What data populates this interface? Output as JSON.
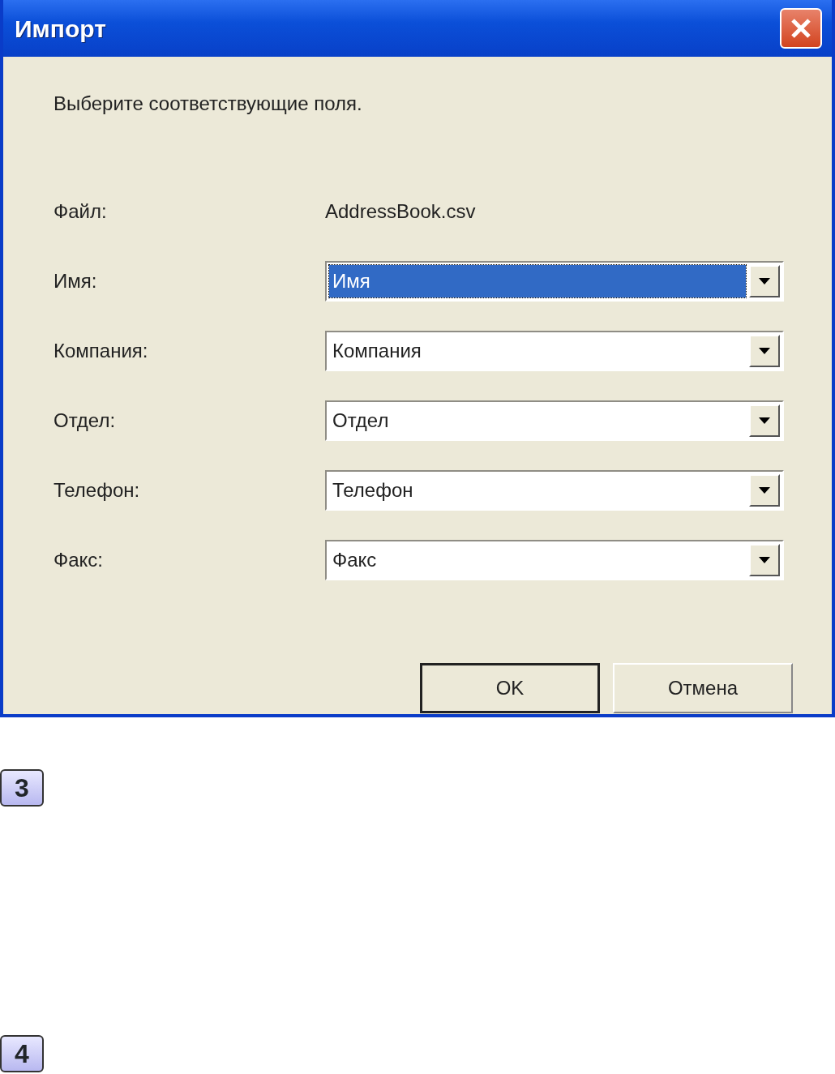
{
  "window": {
    "title": "Импорт"
  },
  "instruction": "Выберите соответствующие поля.",
  "file": {
    "label": "Файл:",
    "value": "AddressBook.csv"
  },
  "fields": [
    {
      "label": "Имя:",
      "value": "Имя",
      "selected": true
    },
    {
      "label": "Компания:",
      "value": "Компания",
      "selected": false
    },
    {
      "label": "Отдел:",
      "value": "Отдел",
      "selected": false
    },
    {
      "label": "Телефон:",
      "value": "Телефон",
      "selected": false
    },
    {
      "label": "Факс:",
      "value": "Факс",
      "selected": false
    }
  ],
  "buttons": [
    {
      "label": "OK",
      "default": true
    },
    {
      "label": "Отмена",
      "default": false
    }
  ],
  "steps": [
    "3",
    "4"
  ]
}
